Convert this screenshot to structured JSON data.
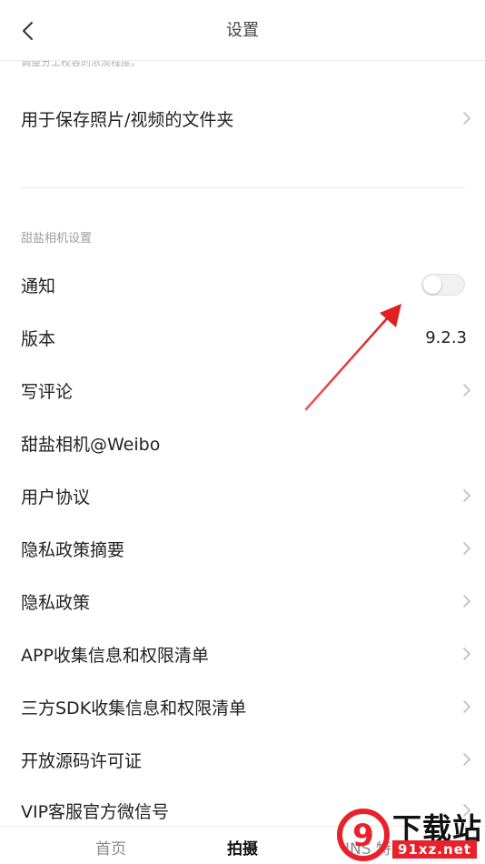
{
  "header": {
    "title": "设置",
    "partial_description": "调整分工校容的浓淡程度。"
  },
  "storage_item": {
    "label": "用于保存照片/视频的文件夹"
  },
  "section": {
    "header": "甜盐相机设置"
  },
  "items": [
    {
      "label": "通知"
    },
    {
      "label": "版本",
      "value": "9.2.3"
    },
    {
      "label": "写评论"
    },
    {
      "label": "甜盐相机@Weibo"
    },
    {
      "label": "用户协议"
    },
    {
      "label": "隐私政策摘要"
    },
    {
      "label": "隐私政策"
    },
    {
      "label": "APP收集信息和权限清单"
    },
    {
      "label": "三方SDK收集信息和权限清单"
    },
    {
      "label": "开放源码许可证"
    },
    {
      "label": "VIP客服官方微信号"
    }
  ],
  "notification_toggle": {
    "enabled": false
  },
  "tabs": [
    {
      "label": "首页",
      "active": false
    },
    {
      "label": "拍摄",
      "active": true
    },
    {
      "label": "INS 特效",
      "active": false
    }
  ],
  "watermark": {
    "brand": "下载站",
    "url": "91xz.net",
    "logo_glyph": "9"
  },
  "colors": {
    "annotation_arrow": "#e02020",
    "watermark_red": "#e8212b"
  }
}
